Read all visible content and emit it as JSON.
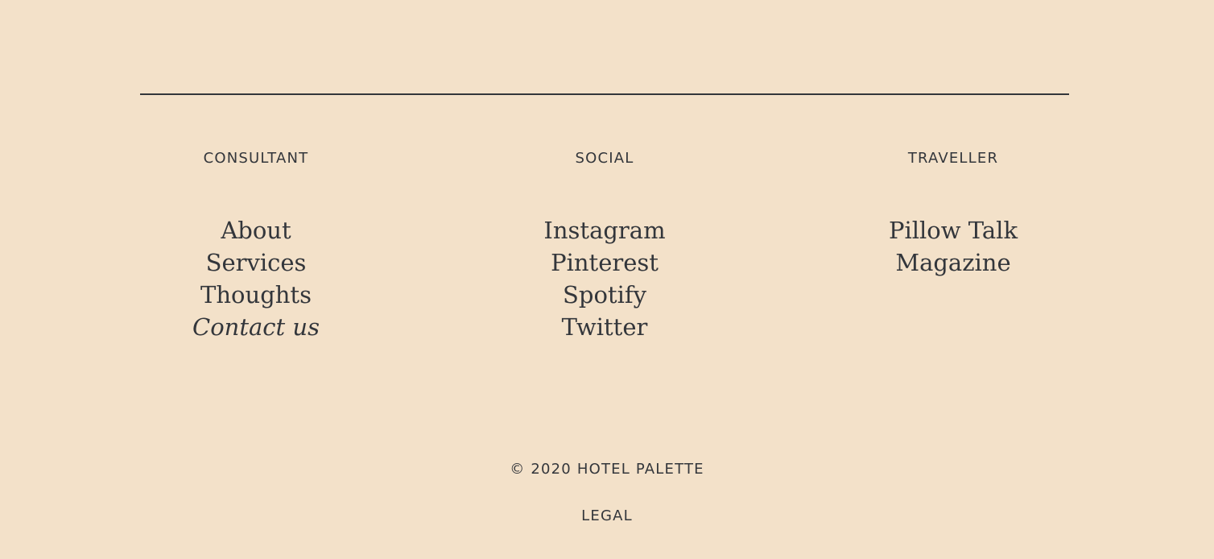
{
  "colors": {
    "background": "#f3e1c9",
    "text": "#33363b",
    "divider": "#33363b"
  },
  "footer": {
    "columns": [
      {
        "heading": "CONSULTANT",
        "links": [
          "About",
          "Services",
          "Thoughts",
          "Contact us"
        ]
      },
      {
        "heading": "SOCIAL",
        "links": [
          "Instagram",
          "Pinterest",
          "Spotify",
          "Twitter"
        ]
      },
      {
        "heading": "TRAVELLER",
        "links": [
          "Pillow Talk",
          "Magazine"
        ]
      }
    ],
    "copyright": "© 2020 HOTEL PALETTE",
    "legal": "LEGAL"
  }
}
